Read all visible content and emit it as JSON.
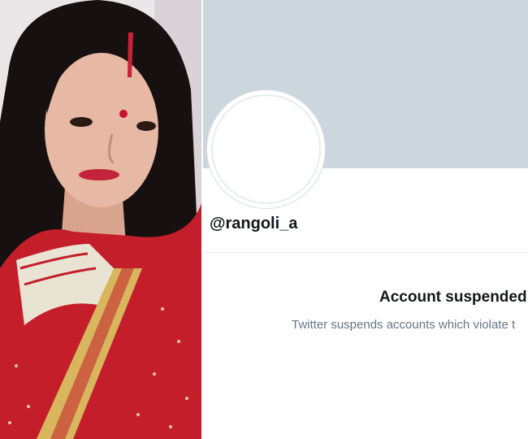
{
  "profile": {
    "handle": "@rangoli_a",
    "banner_color": "#ccd6dd",
    "avatar": "empty-avatar"
  },
  "notice": {
    "title": "Account suspended",
    "description": "Twitter suspends accounts which violate t"
  },
  "photo": {
    "subject": "woman in red saree",
    "dominant_colors": [
      "#c41e2a",
      "#1b1414",
      "#e8e4e6"
    ]
  }
}
